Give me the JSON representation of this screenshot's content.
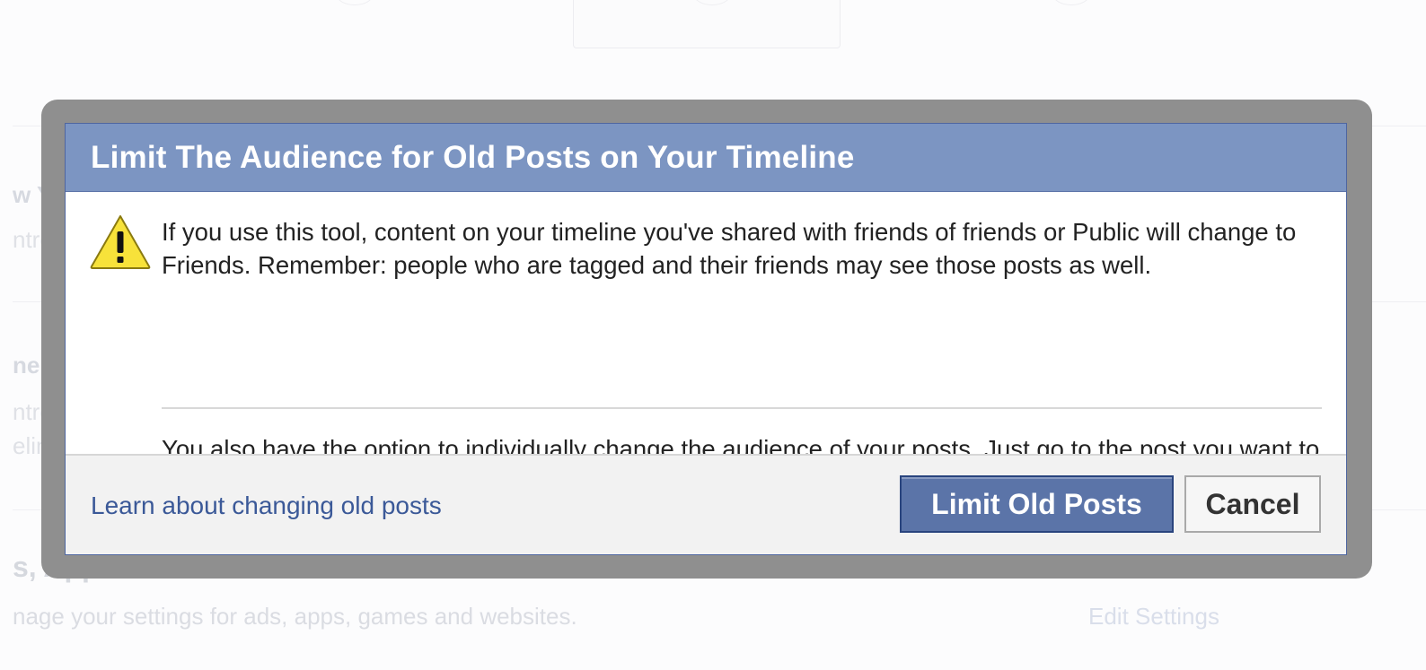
{
  "background": {
    "fragments": [
      "w Y",
      "ntrol",
      "nel",
      "ntrol",
      "eline"
    ],
    "section_title": "s, Apps and Websites",
    "section_description": "nage your settings for ads, apps, games and websites.",
    "edit_settings": "Edit Settings"
  },
  "dialog": {
    "title": "Limit The Audience for Old Posts on Your Timeline",
    "warning_icon": "warning-triangle-icon",
    "paragraph1": "If you use this tool, content on your timeline you've shared with friends of friends or Public will change to Friends. Remember: people who are tagged and their friends may see those posts as well.",
    "paragraph2": "You also have the option to individually change the audience of your posts. Just go to the post you want to change and choose a different audience.",
    "learn_link": "Learn about changing old posts",
    "primary_button": "Limit Old Posts",
    "cancel_button": "Cancel"
  },
  "colors": {
    "header_bg": "#7c95c2",
    "link": "#3b5998",
    "primary_button": "#5b74a8",
    "frame": "#8f8f8f"
  }
}
